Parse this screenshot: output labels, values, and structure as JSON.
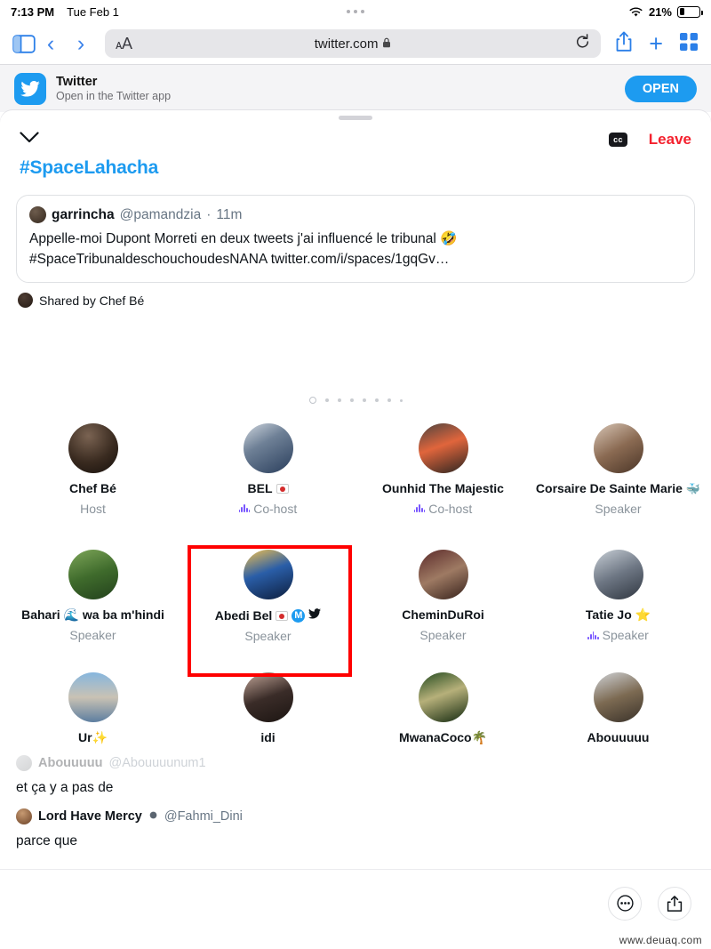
{
  "statusbar": {
    "time": "7:13 PM",
    "date": "Tue Feb 1",
    "battery_percent": "21%",
    "wifi_icon": "wifi-icon",
    "battery_icon": "battery-icon"
  },
  "safari": {
    "sidebar_icon": "sidebar-icon",
    "back_icon": "chevron-left-icon",
    "forward_icon": "chevron-right-icon",
    "text_size_label": "AA",
    "url": "twitter.com",
    "lock_icon": "lock-icon",
    "reload_icon": "reload-icon",
    "share_icon": "share-icon",
    "new_tab_icon": "plus-icon",
    "tabs_icon": "tab-overview-icon"
  },
  "app_banner": {
    "logo_icon": "twitter-bird-icon",
    "title": "Twitter",
    "subtitle": "Open in the Twitter app",
    "open_label": "OPEN"
  },
  "space": {
    "collapse_icon": "chevron-down-icon",
    "cc_label": "cc",
    "leave_label": "Leave",
    "title": "#SpaceLahacha"
  },
  "tweet_card": {
    "author": "garrincha",
    "handle": "@pamandzia",
    "separator": "·",
    "time": "11m",
    "body_line1": "Appelle-moi Dupont Morreti en deux tweets j'ai influencé le tribunal 🤣",
    "body_line2": "#SpaceTribunaldeschouchoudesNANA twitter.com/i/spaces/1gqGv…"
  },
  "shared_by": {
    "label": "Shared by Chef Bé"
  },
  "page_dots": {
    "count": 8,
    "active_index": 0
  },
  "participants": [
    {
      "name": "Chef Bé",
      "role": "Host",
      "speaking": false,
      "badges": [],
      "avatar": "radial-gradient(circle at 40% 25%, #7a6352 0%, #3a2b20 55%, #150f0b 100%)"
    },
    {
      "name": "BEL",
      "role": "Co-host",
      "speaking": true,
      "badges": [
        "flag"
      ],
      "avatar": "linear-gradient(150deg,#cfd6de 0%,#6e8096 40%,#2a3e5c 100%)"
    },
    {
      "name": "Ounhid The Majestic",
      "role": "Co-host",
      "speaking": true,
      "badges": [],
      "avatar": "linear-gradient(160deg,#4b4340 0%,#e0653c 45%,#2a2521 100%)"
    },
    {
      "name": "Corsaire De Sainte Marie",
      "role": "Speaker",
      "speaking": false,
      "badges": [
        "whale"
      ],
      "avatar": "linear-gradient(150deg,#d8c6b6 0%,#8a6a52 50%,#4a3527 100%)"
    },
    {
      "name": "Bahari 🌊 wa ba m'hindi",
      "role": "Speaker",
      "speaking": false,
      "badges": [],
      "avatar": "linear-gradient(160deg,#7ea659 0%,#3f6b2c 50%,#23411c 100%)"
    },
    {
      "name": "Abedi Bel",
      "role": "Speaker",
      "speaking": false,
      "badges": [
        "flag",
        "m",
        "twitter"
      ],
      "avatar": "linear-gradient(160deg,#f2c14e 0%,#2a5ea8 45%,#0d1e3d 100%)",
      "selected": true
    },
    {
      "name": "CheminDuRoi",
      "role": "Speaker",
      "speaking": false,
      "badges": [],
      "avatar": "linear-gradient(155deg,#5b2a2a 0%,#9e7a63 50%,#35201a 100%)"
    },
    {
      "name": "Tatie Jo ⭐",
      "role": "Speaker",
      "speaking": true,
      "badges": [],
      "avatar": "linear-gradient(155deg,#c8cfd6 0%,#6d7683 50%,#2f3640 100%)"
    },
    {
      "name": "Ur✨",
      "role": "",
      "speaking": false,
      "badges": [],
      "avatar": "linear-gradient(180deg,#86b6de 0%,#c9c2b4 50%,#5d7ea0 100%)"
    },
    {
      "name": "idi",
      "role": "",
      "speaking": false,
      "badges": [],
      "avatar": "linear-gradient(160deg,#c3a79a 0%,#3a2c28 50%,#1c1512 100%)"
    },
    {
      "name": "MwanaCoco🌴",
      "role": "",
      "speaking": false,
      "badges": [],
      "avatar": "linear-gradient(160deg,#234a1f 0%,#b6b07a 45%,#13290f 100%)"
    },
    {
      "name": "Abouuuuu",
      "role": "",
      "speaking": false,
      "badges": [],
      "avatar": "linear-gradient(160deg,#cfd2d6 0%,#7c6a52 50%,#3a322a 100%)"
    }
  ],
  "transcript": [
    {
      "name": "Abouuuuu",
      "handle": "@Abouuuunum1",
      "verified": false,
      "text": "et ça y a pas de",
      "faded": true
    },
    {
      "name": "Lord Have Mercy",
      "handle": "@Fahmi_Dini",
      "verified": true,
      "text": "parce que",
      "faded": false
    }
  ],
  "bottom_bar": {
    "more_icon": "more-circle-icon",
    "share_icon": "share-up-icon"
  },
  "watermark": "www.deuaq.com",
  "colors": {
    "twitter_blue": "#1d9bf0",
    "leave_red": "#f4212e",
    "speaking_purple": "#7856ff",
    "selection_red": "#ff0000",
    "muted_gray": "#8a939b"
  }
}
